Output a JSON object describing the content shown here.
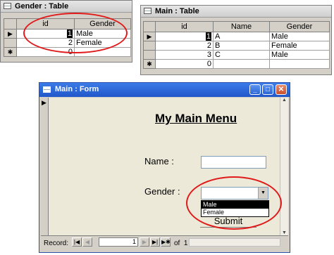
{
  "gender_table": {
    "title": "Gender : Table",
    "columns": [
      "id",
      "Gender"
    ],
    "rows": [
      {
        "selector": "▶",
        "id": "1",
        "gender": "Male"
      },
      {
        "selector": "",
        "id": "2",
        "gender": "Female"
      },
      {
        "selector": "✱",
        "id": "0",
        "gender": ""
      }
    ]
  },
  "main_table": {
    "title": "Main : Table",
    "columns": [
      "id",
      "Name",
      "Gender"
    ],
    "rows": [
      {
        "selector": "▶",
        "id": "1",
        "name": "A",
        "gender": "Male"
      },
      {
        "selector": "",
        "id": "2",
        "name": "B",
        "gender": "Female"
      },
      {
        "selector": "",
        "id": "3",
        "name": "C",
        "gender": "Male"
      },
      {
        "selector": "✱",
        "id": "0",
        "name": "",
        "gender": ""
      }
    ]
  },
  "main_form": {
    "title": "Main : Form",
    "heading": "My Main Menu",
    "name_label": "Name :",
    "name_value": "",
    "gender_label": "Gender :",
    "gender_value": "",
    "gender_options": [
      "Male",
      "Female"
    ],
    "submit_label": "Submit",
    "record_label": "Record:",
    "record_current": "1",
    "record_total": "of  1"
  },
  "colors": {
    "highlight_ellipse": "#e01a1a",
    "dropdown_selected_bg": "#000000",
    "form_titlebar": "#2157c9"
  }
}
